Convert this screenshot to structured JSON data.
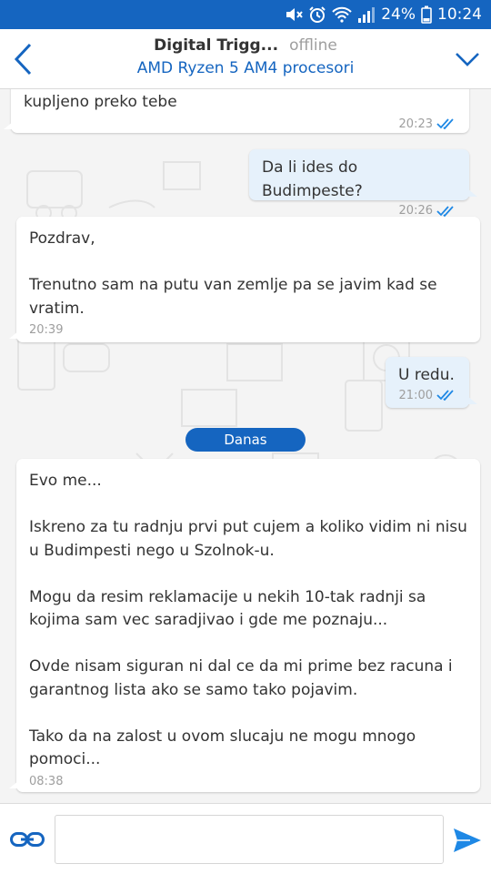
{
  "status_bar": {
    "battery": "24%",
    "time": "10:24",
    "icons": [
      "mute-icon",
      "alarm-icon",
      "wifi-icon",
      "signal-icon",
      "battery-icon"
    ]
  },
  "header": {
    "name": "Digital Trigg...",
    "presence": "offline",
    "subject": "AMD Ryzen 5 AM4 procesori"
  },
  "messages": [
    {
      "direction": "in",
      "paragraphs": [
        "kupljeno preko tebe"
      ],
      "time": "20:23",
      "read": true
    },
    {
      "direction": "out",
      "paragraphs": [
        "Da li ides do Budimpeste?"
      ],
      "time": "20:26",
      "read": true
    },
    {
      "direction": "in",
      "paragraphs": [
        "Pozdrav,",
        "Trenutno sam na putu van zemlje pa se javim kad se vratim."
      ],
      "time": "20:39"
    },
    {
      "direction": "out",
      "paragraphs": [
        "U redu."
      ],
      "time": "21:00",
      "read": true
    },
    {
      "direction": "in",
      "paragraphs": [
        "Evo me...",
        "Iskreno za tu radnju prvi put cujem a koliko vidim ni nisu u Budimpesti nego u Szolnok-u.",
        "Mogu da resim reklamacije u nekih 10-tak radnji sa kojima sam vec saradjivao i gde me poznaju...",
        "Ovde nisam siguran ni dal ce da mi prime bez racuna i garantnog lista ako se samo tako pojavim.",
        "Tako da na zalost u ovom slucaju ne mogu mnogo pomoci..."
      ],
      "time": "08:38"
    }
  ],
  "day_divider": "Danas",
  "composer": {
    "value": "",
    "placeholder": ""
  },
  "colors": {
    "accent": "#1565c0",
    "outgoing_bubble": "#e6f1fb",
    "incoming_bubble": "#ffffff",
    "tick": "#1e88e5"
  }
}
